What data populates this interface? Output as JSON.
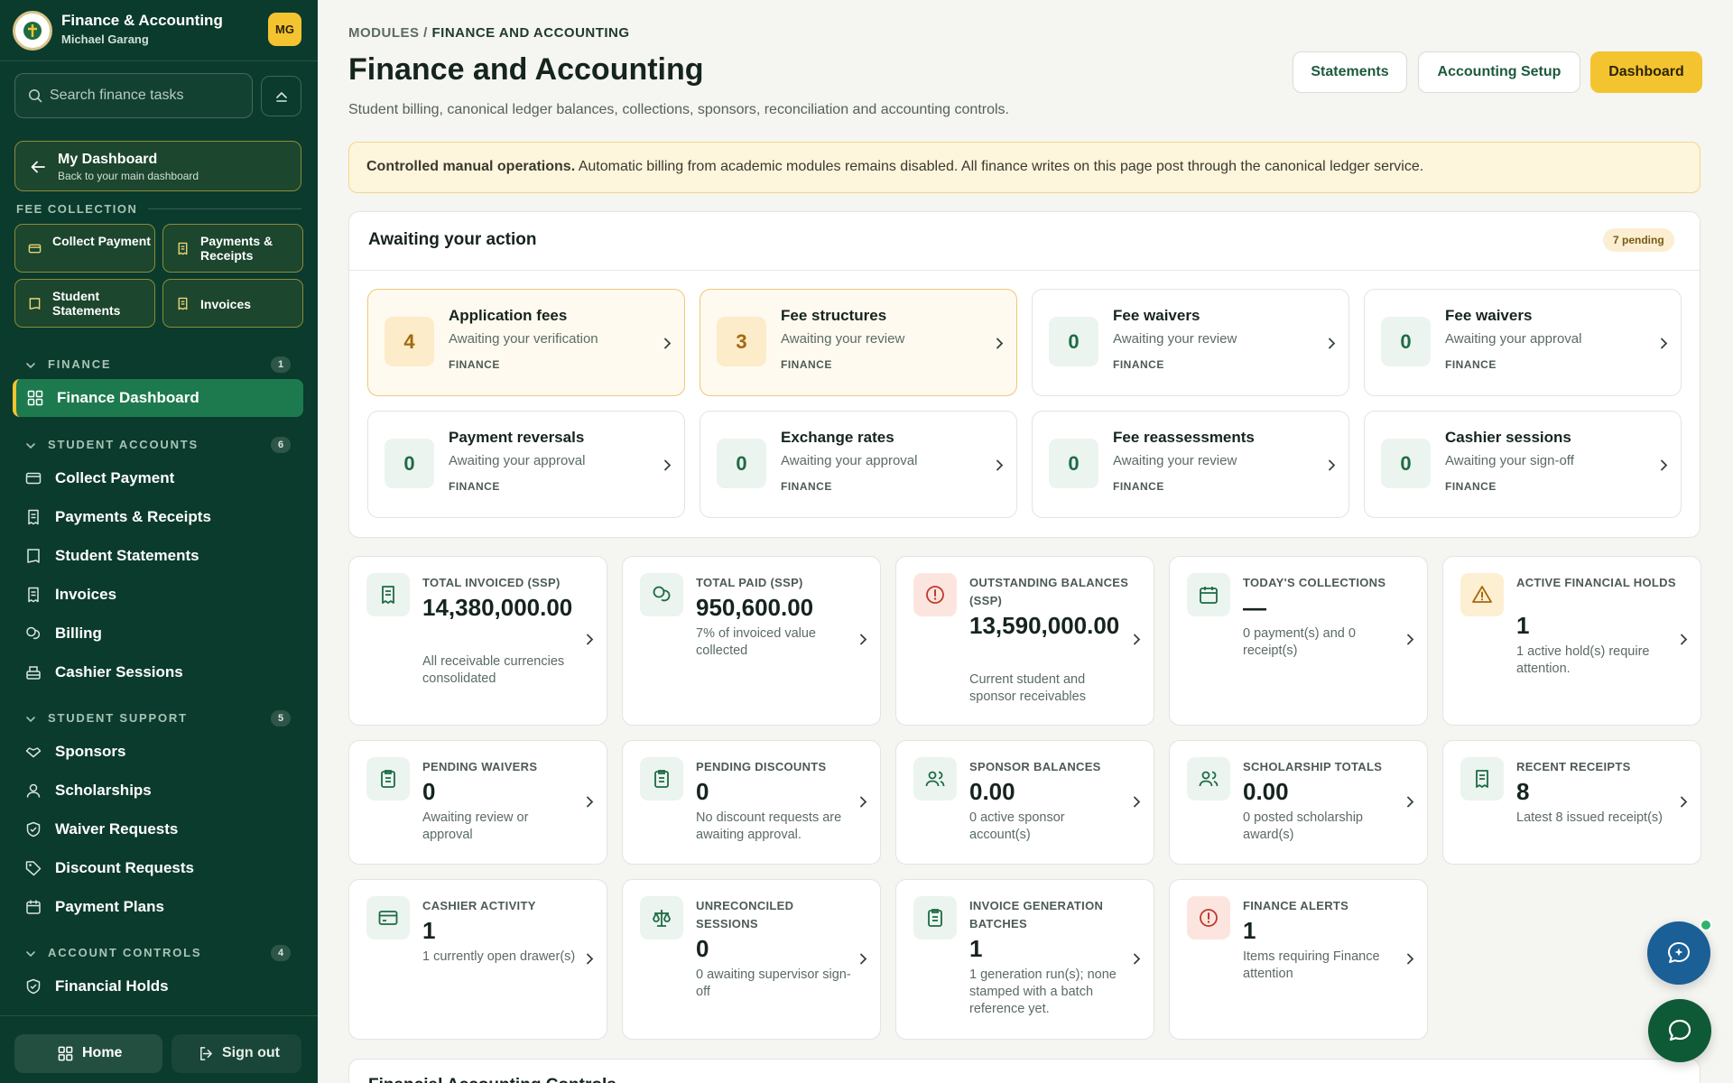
{
  "sidebar": {
    "app_title": "Finance & Accounting",
    "user_name": "Michael Garang",
    "avatar_initials": "MG",
    "search_placeholder": "Search finance tasks",
    "my_dashboard": {
      "title": "My Dashboard",
      "subtitle": "Back to your main dashboard"
    },
    "fee_collection_label": "FEE COLLECTION",
    "quick_actions": [
      "Collect Payment",
      "Payments & Receipts",
      "Student Statements",
      "Invoices"
    ],
    "sections": [
      {
        "label": "FINANCE",
        "count": "1",
        "items": [
          "Finance Dashboard"
        ]
      },
      {
        "label": "STUDENT ACCOUNTS",
        "count": "6",
        "items": [
          "Collect Payment",
          "Payments & Receipts",
          "Student Statements",
          "Invoices",
          "Billing",
          "Cashier Sessions"
        ]
      },
      {
        "label": "STUDENT SUPPORT",
        "count": "5",
        "items": [
          "Sponsors",
          "Scholarships",
          "Waiver Requests",
          "Discount Requests",
          "Payment Plans"
        ]
      },
      {
        "label": "ACCOUNT CONTROLS",
        "count": "4",
        "items": [
          "Financial Holds"
        ]
      }
    ],
    "footer": {
      "home": "Home",
      "sign_out": "Sign out"
    }
  },
  "header": {
    "breadcrumb_root": "MODULES",
    "breadcrumb_current": "FINANCE AND ACCOUNTING",
    "title": "Finance and Accounting",
    "subtitle": "Student billing, canonical ledger balances, collections, sponsors, reconciliation and accounting controls.",
    "buttons": [
      "Statements",
      "Accounting Setup",
      "Dashboard"
    ]
  },
  "banner": {
    "bold": "Controlled manual operations.",
    "text": " Automatic billing from academic modules remains disabled. All finance writes on this page post through the canonical ledger service."
  },
  "awaiting": {
    "title": "Awaiting your action",
    "pending": "7 pending",
    "cards": [
      {
        "count": "4",
        "title": "Application fees",
        "subtitle": "Awaiting your verification",
        "category": "FINANCE",
        "highlight": true
      },
      {
        "count": "3",
        "title": "Fee structures",
        "subtitle": "Awaiting your review",
        "category": "FINANCE",
        "highlight": true
      },
      {
        "count": "0",
        "title": "Fee waivers",
        "subtitle": "Awaiting your review",
        "category": "FINANCE",
        "highlight": false
      },
      {
        "count": "0",
        "title": "Fee waivers",
        "subtitle": "Awaiting your approval",
        "category": "FINANCE",
        "highlight": false
      },
      {
        "count": "0",
        "title": "Payment reversals",
        "subtitle": "Awaiting your approval",
        "category": "FINANCE",
        "highlight": false
      },
      {
        "count": "0",
        "title": "Exchange rates",
        "subtitle": "Awaiting your approval",
        "category": "FINANCE",
        "highlight": false
      },
      {
        "count": "0",
        "title": "Fee reassessments",
        "subtitle": "Awaiting your review",
        "category": "FINANCE",
        "highlight": false
      },
      {
        "count": "0",
        "title": "Cashier sessions",
        "subtitle": "Awaiting your sign-off",
        "category": "FINANCE",
        "highlight": false
      }
    ]
  },
  "stats": [
    {
      "label": "TOTAL INVOICED (SSP)",
      "value": "14,380,000.00",
      "desc": "All receivable currencies consolidated",
      "icon": "receipt-icon",
      "tone": "green"
    },
    {
      "label": "TOTAL PAID (SSP)",
      "value": "950,600.00",
      "desc": "7% of invoiced value collected",
      "icon": "coins-icon",
      "tone": "green"
    },
    {
      "label": "OUTSTANDING BALANCES (SSP)",
      "value": "13,590,000.00",
      "desc": "Current student and sponsor receivables",
      "icon": "alert-circle-icon",
      "tone": "red"
    },
    {
      "label": "TODAY'S COLLECTIONS",
      "value": "—",
      "desc": "0 payment(s) and 0 receipt(s)",
      "icon": "calendar-icon",
      "tone": "green"
    },
    {
      "label": "ACTIVE FINANCIAL HOLDS",
      "value": "1",
      "desc": "1 active hold(s) require attention.",
      "icon": "warning-icon",
      "tone": "amber"
    },
    {
      "label": "PENDING WAIVERS",
      "value": "0",
      "desc": "Awaiting review or approval",
      "icon": "clipboard-icon",
      "tone": "green"
    },
    {
      "label": "PENDING DISCOUNTS",
      "value": "0",
      "desc": "No discount requests are awaiting approval.",
      "icon": "clipboard-icon",
      "tone": "green"
    },
    {
      "label": "SPONSOR BALANCES",
      "value": "0.00",
      "desc": "0 active sponsor account(s)",
      "icon": "users-icon",
      "tone": "green"
    },
    {
      "label": "SCHOLARSHIP TOTALS",
      "value": "0.00",
      "desc": "0 posted scholarship award(s)",
      "icon": "users-icon",
      "tone": "green"
    },
    {
      "label": "RECENT RECEIPTS",
      "value": "8",
      "desc": "Latest 8 issued receipt(s)",
      "icon": "receipt-icon",
      "tone": "green"
    },
    {
      "label": "CASHIER ACTIVITY",
      "value": "1",
      "desc": "1 currently open drawer(s)",
      "icon": "card-icon",
      "tone": "green"
    },
    {
      "label": "UNRECONCILED SESSIONS",
      "value": "0",
      "desc": "0 awaiting supervisor sign-off",
      "icon": "scale-icon",
      "tone": "green"
    },
    {
      "label": "INVOICE GENERATION BATCHES",
      "value": "1",
      "desc": "1 generation run(s); none stamped with a batch reference yet.",
      "icon": "clipboard-icon",
      "tone": "green"
    },
    {
      "label": "FINANCE ALERTS",
      "value": "1",
      "desc": "Items requiring Finance attention",
      "icon": "alert-circle-icon",
      "tone": "red"
    }
  ],
  "next_section_title": "Financial Accounting Controls",
  "colors": {
    "sidebar_bg": "#0b3b2c",
    "accent_green": "#1d7a4f",
    "accent_yellow": "#f4c430",
    "chat_blue": "#1a5f95"
  }
}
